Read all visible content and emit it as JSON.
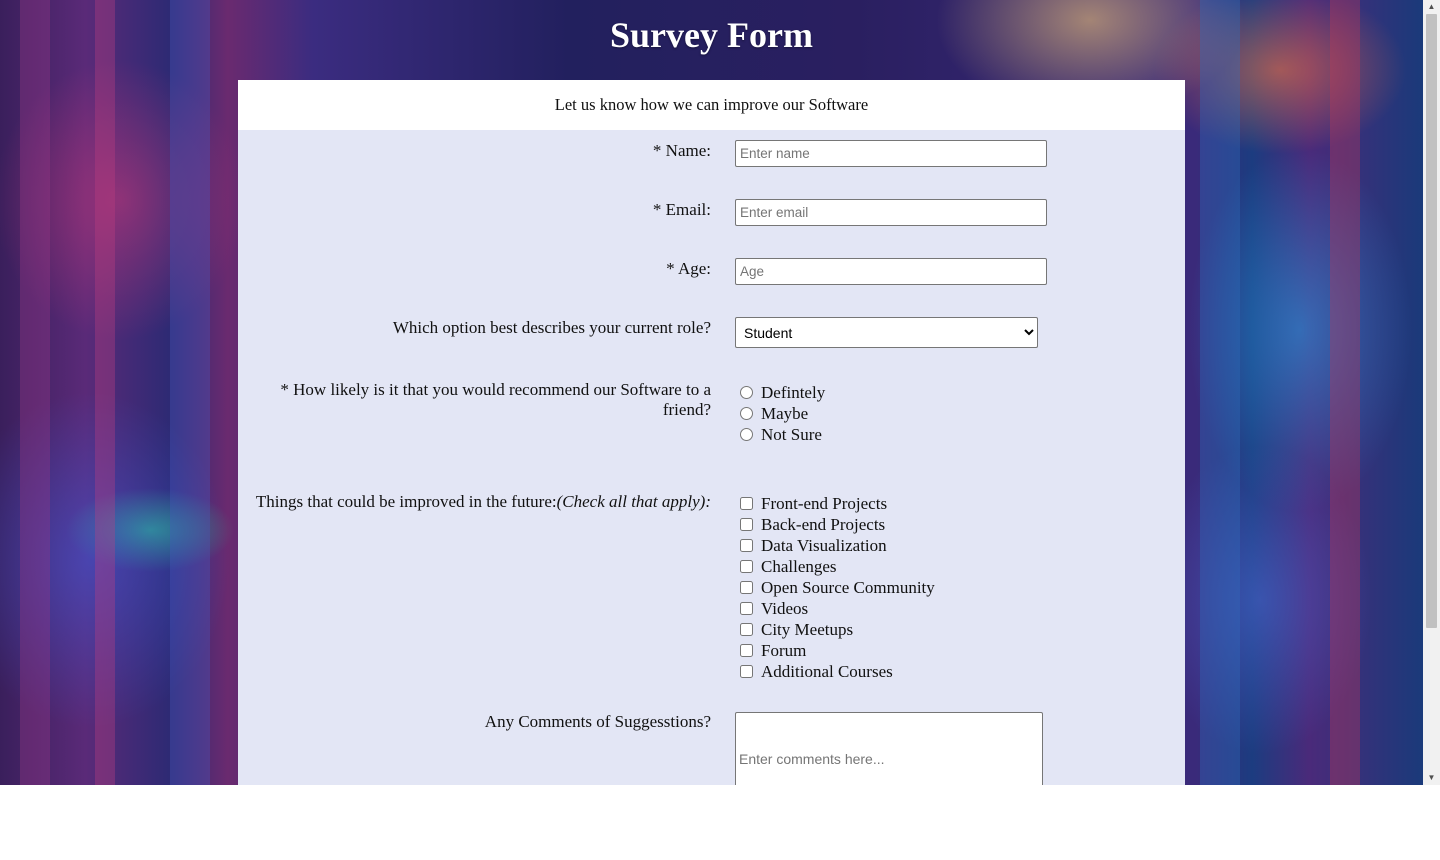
{
  "header": {
    "title": "Survey Form"
  },
  "form": {
    "subtitle": "Let us know how we can improve our Software",
    "name": {
      "label": "* Name:",
      "placeholder": "Enter name"
    },
    "email": {
      "label": "* Email:",
      "placeholder": "Enter email"
    },
    "age": {
      "label": "* Age:",
      "placeholder": "Age"
    },
    "role": {
      "label": "Which option best describes your current role?",
      "selected": "Student"
    },
    "recommend": {
      "label_line1": "* How likely is it that you would recommend our Software to a",
      "label_line2": "friend?",
      "options": [
        "Defintely",
        "Maybe",
        "Not Sure"
      ]
    },
    "improve": {
      "label": "Things that could be improved in the future:",
      "label_note": "(Check all that apply):",
      "options": [
        "Front-end Projects",
        "Back-end Projects",
        "Data Visualization",
        "Challenges",
        "Open Source Community",
        "Videos",
        "City Meetups",
        "Forum",
        "Additional Courses"
      ]
    },
    "comments": {
      "label": "Any Comments of Suggesstions?",
      "placeholder": "Enter comments here..."
    }
  },
  "scrollbar": {
    "up_icon": "▲",
    "down_icon": "▼"
  }
}
